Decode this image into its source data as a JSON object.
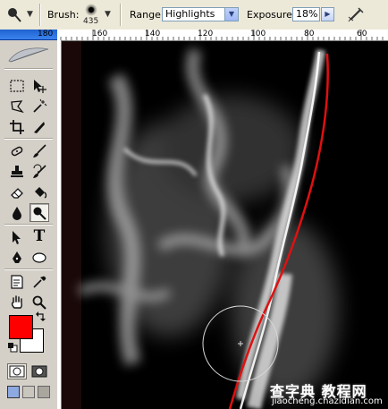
{
  "options_bar": {
    "tool_icon": "dodge-burn-tool-icon",
    "brush_label": "Brush:",
    "brush_size": "435",
    "range_label": "Range:",
    "range_value": "Highlights",
    "exposure_label": "Exposure:",
    "exposure_value": "18%",
    "airbrush_icon": "airbrush-icon"
  },
  "ruler": {
    "labels": [
      "180",
      "160",
      "140",
      "120",
      "100",
      "80",
      "60"
    ]
  },
  "toolbox": {
    "tools": [
      "rectangular-marquee-icon",
      "move-icon",
      "lasso-icon",
      "magic-wand-icon",
      "crop-icon",
      "slice-icon",
      "healing-brush-icon",
      "brush-icon",
      "clone-stamp-icon",
      "history-brush-icon",
      "eraser-icon",
      "paint-bucket-icon",
      "blur-icon",
      "dodge-burn-icon",
      "path-selection-icon",
      "type-icon",
      "pen-icon",
      "ellipse-shape-icon",
      "notes-icon",
      "eyedropper-icon",
      "hand-icon",
      "zoom-icon"
    ],
    "type_glyph": "T",
    "active_tool": "dodge-burn-icon",
    "foreground_color": "#ff0000",
    "background_color": "#ffffff"
  },
  "watermark": {
    "title": "查字典 教程网",
    "url": "jiaocheng.chazidian.com"
  },
  "colors": {
    "accent_title_bar": "#1e62d0",
    "canvas_background": "#000000",
    "highlight_stroke": "#e01010"
  }
}
